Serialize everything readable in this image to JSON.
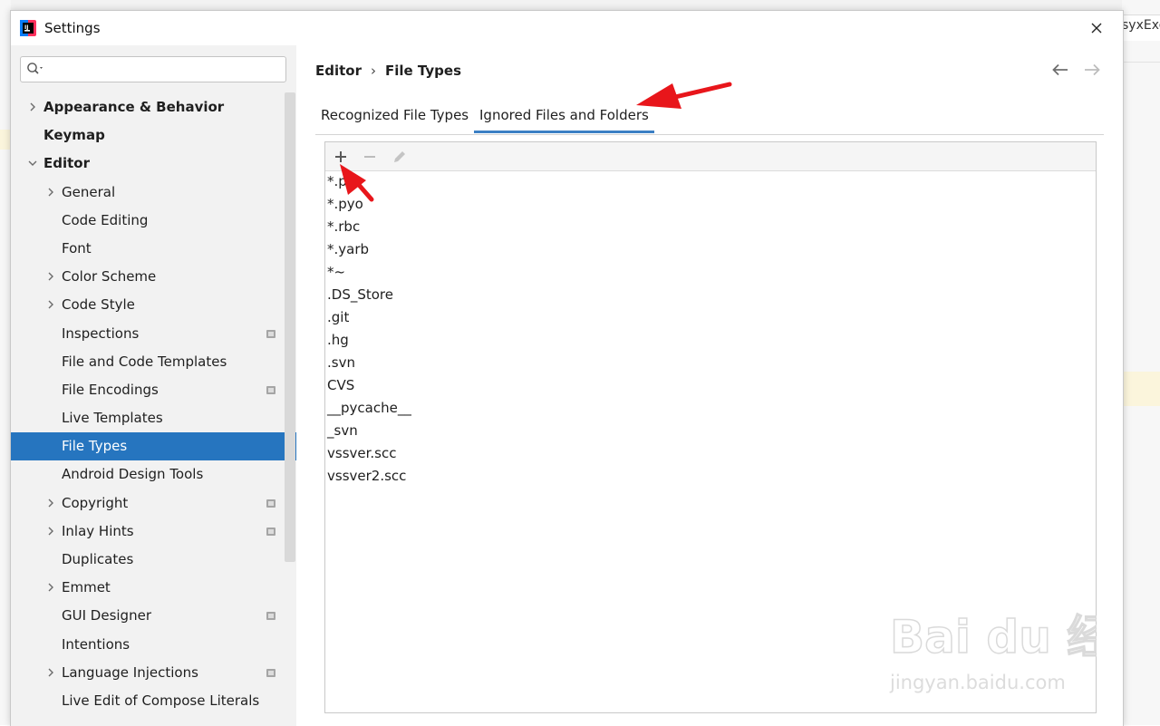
{
  "background": {
    "right_tab_text": "syxExc"
  },
  "dialog": {
    "title": "Settings",
    "close_icon": "close-icon"
  },
  "sidebar": {
    "search": {
      "value": "",
      "placeholder": ""
    },
    "items": [
      {
        "label": "Appearance & Behavior",
        "level": 0,
        "expandable": true,
        "expanded": false,
        "bold": true,
        "project": false,
        "selected": false
      },
      {
        "label": "Keymap",
        "level": 0,
        "expandable": false,
        "bold": true,
        "project": false,
        "selected": false
      },
      {
        "label": "Editor",
        "level": 0,
        "expandable": true,
        "expanded": true,
        "bold": true,
        "project": false,
        "selected": false
      },
      {
        "label": "General",
        "level": 1,
        "expandable": true,
        "expanded": false,
        "bold": false,
        "project": false,
        "selected": false
      },
      {
        "label": "Code Editing",
        "level": 1,
        "expandable": false,
        "bold": false,
        "project": false,
        "selected": false
      },
      {
        "label": "Font",
        "level": 1,
        "expandable": false,
        "bold": false,
        "project": false,
        "selected": false
      },
      {
        "label": "Color Scheme",
        "level": 1,
        "expandable": true,
        "expanded": false,
        "bold": false,
        "project": false,
        "selected": false
      },
      {
        "label": "Code Style",
        "level": 1,
        "expandable": true,
        "expanded": false,
        "bold": false,
        "project": false,
        "selected": false
      },
      {
        "label": "Inspections",
        "level": 1,
        "expandable": false,
        "bold": false,
        "project": true,
        "selected": false
      },
      {
        "label": "File and Code Templates",
        "level": 1,
        "expandable": false,
        "bold": false,
        "project": false,
        "selected": false
      },
      {
        "label": "File Encodings",
        "level": 1,
        "expandable": false,
        "bold": false,
        "project": true,
        "selected": false
      },
      {
        "label": "Live Templates",
        "level": 1,
        "expandable": false,
        "bold": false,
        "project": false,
        "selected": false
      },
      {
        "label": "File Types",
        "level": 1,
        "expandable": false,
        "bold": false,
        "project": false,
        "selected": true
      },
      {
        "label": "Android Design Tools",
        "level": 1,
        "expandable": false,
        "bold": false,
        "project": false,
        "selected": false
      },
      {
        "label": "Copyright",
        "level": 1,
        "expandable": true,
        "expanded": false,
        "bold": false,
        "project": true,
        "selected": false
      },
      {
        "label": "Inlay Hints",
        "level": 1,
        "expandable": true,
        "expanded": false,
        "bold": false,
        "project": true,
        "selected": false
      },
      {
        "label": "Duplicates",
        "level": 1,
        "expandable": false,
        "bold": false,
        "project": false,
        "selected": false
      },
      {
        "label": "Emmet",
        "level": 1,
        "expandable": true,
        "expanded": false,
        "bold": false,
        "project": false,
        "selected": false
      },
      {
        "label": "GUI Designer",
        "level": 1,
        "expandable": false,
        "bold": false,
        "project": true,
        "selected": false
      },
      {
        "label": "Intentions",
        "level": 1,
        "expandable": false,
        "bold": false,
        "project": false,
        "selected": false
      },
      {
        "label": "Language Injections",
        "level": 1,
        "expandable": true,
        "expanded": false,
        "bold": false,
        "project": true,
        "selected": false
      },
      {
        "label": "Live Edit of Compose Literals",
        "level": 1,
        "expandable": false,
        "bold": false,
        "project": false,
        "selected": false
      }
    ]
  },
  "main": {
    "breadcrumb": {
      "parent": "Editor",
      "separator": "›",
      "current": "File Types"
    },
    "tabs": [
      {
        "label": "Recognized File Types",
        "active": false
      },
      {
        "label": "Ignored Files and Folders",
        "active": true
      }
    ],
    "toolbar": {
      "add_icon": "plus-icon",
      "remove_icon": "minus-icon",
      "edit_icon": "pencil-icon"
    },
    "ignored_patterns": [
      "*.pyc",
      "*.pyo",
      "*.rbc",
      "*.yarb",
      "*~",
      ".DS_Store",
      ".git",
      ".hg",
      ".svn",
      "CVS",
      "__pycache__",
      "_svn",
      "vssver.scc",
      "vssver2.scc"
    ]
  },
  "watermark": {
    "text": "jingyan.baidu.com"
  },
  "colors": {
    "selection": "#2675bf",
    "tab_underline": "#3b7fc4",
    "annotation_arrow": "#e8161b"
  }
}
